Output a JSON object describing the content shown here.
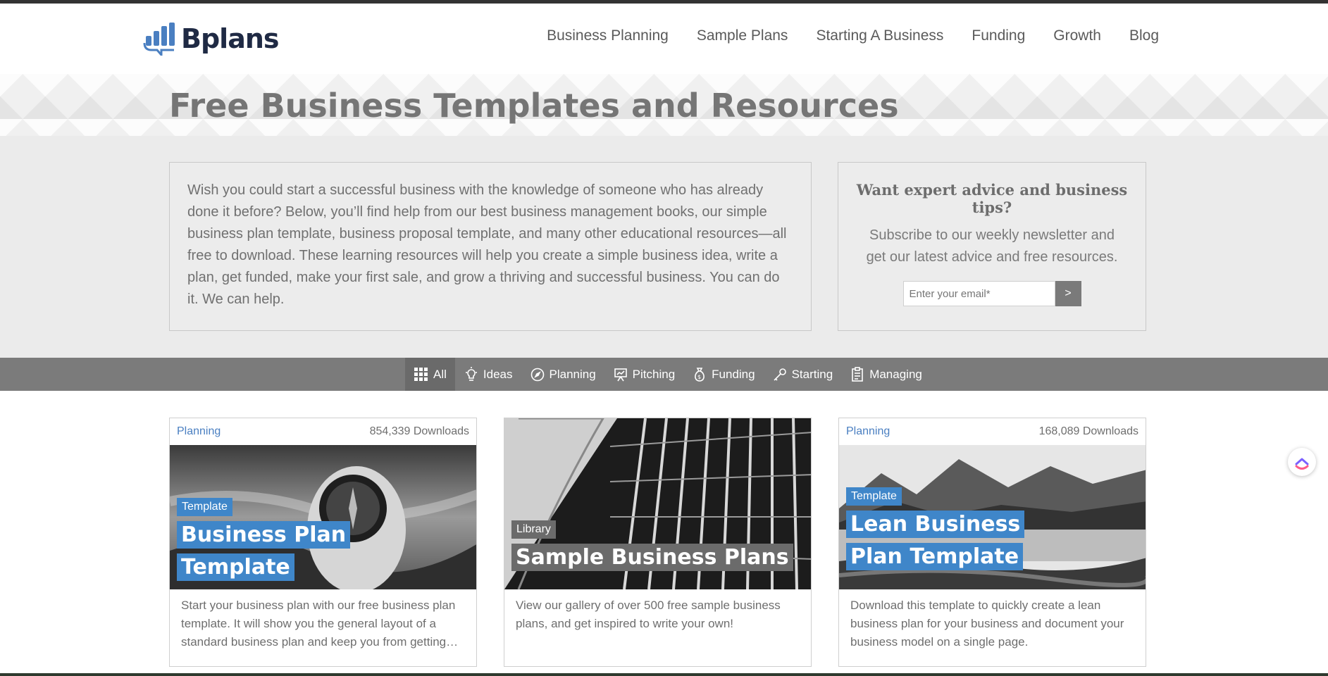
{
  "brand": {
    "name": "Bplans",
    "mark_color": "#4a7fc1"
  },
  "nav": {
    "items": [
      "Business Planning",
      "Sample Plans",
      "Starting A Business",
      "Funding",
      "Growth",
      "Blog"
    ]
  },
  "hero": {
    "title": "Free Business Templates and Resources"
  },
  "intro": {
    "text": "Wish you could start a successful business with the knowledge of someone who has already done it before? Below, you’ll find help from our best business management books, our simple business plan template, business proposal template, and many other educational resources—all free to download. These learning resources will help you create a simple business idea, write a plan, get funded, make your first sale, and grow a thriving and successful business. You can do it. We can help."
  },
  "subscribe": {
    "title": "Want expert advice and business tips?",
    "text": "Subscribe to our weekly newsletter and get our latest advice and free resources.",
    "placeholder": "Enter your email*",
    "submit_label": ">"
  },
  "filters": [
    {
      "label": "All",
      "icon": "grid-icon",
      "active": true
    },
    {
      "label": "Ideas",
      "icon": "lightbulb-icon"
    },
    {
      "label": "Planning",
      "icon": "compass-icon"
    },
    {
      "label": "Pitching",
      "icon": "presentation-icon"
    },
    {
      "label": "Funding",
      "icon": "money-bag-icon"
    },
    {
      "label": "Starting",
      "icon": "key-icon"
    },
    {
      "label": "Managing",
      "icon": "clipboard-icon"
    }
  ],
  "cards": [
    {
      "category": "Planning",
      "downloads": "854,339 Downloads",
      "badge": "Template",
      "title": "Business Plan Template",
      "description": "Start your business plan with our free business plan template. It will show you the general layout of a standard business plan and keep you from getting…"
    },
    {
      "category": "",
      "downloads": "",
      "badge": "Library",
      "title": "Sample Business Plans",
      "description": "View our gallery of over 500 free sample business plans, and get inspired to write your own!"
    },
    {
      "category": "Planning",
      "downloads": "168,089 Downloads",
      "badge": "Template",
      "title": "Lean Business Plan Template",
      "description": "Download this template to quickly create a lean business plan for your business and document your business model on a single page."
    }
  ],
  "colors": {
    "accent_blue": "#3f86c9",
    "filter_bar": "#7b7b7b"
  }
}
